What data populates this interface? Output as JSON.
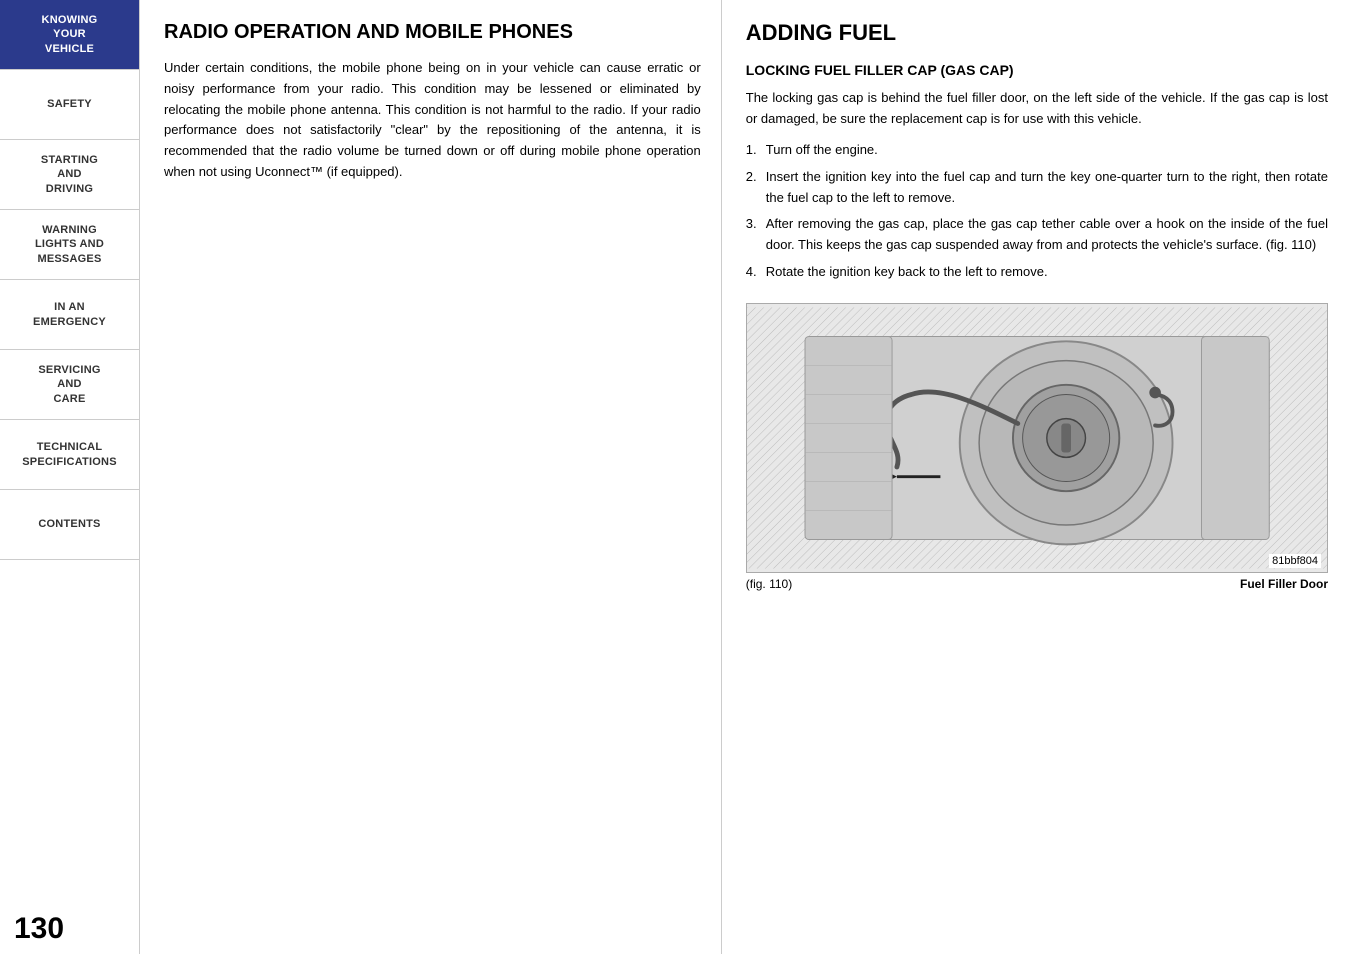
{
  "sidebar": {
    "items": [
      {
        "id": "knowing-your-vehicle",
        "label": "KNOWING\nYOUR\nVEHICLE",
        "active": true
      },
      {
        "id": "safety",
        "label": "SAFETY",
        "active": false
      },
      {
        "id": "starting-and-driving",
        "label": "STARTING\nAND\nDRIVING",
        "active": false
      },
      {
        "id": "warning-lights-and-messages",
        "label": "WARNING\nLIGHTS AND\nMESSAGES",
        "active": false
      },
      {
        "id": "in-an-emergency",
        "label": "IN AN\nEMERGENCY",
        "active": false
      },
      {
        "id": "servicing-and-care",
        "label": "SERVICING\nAND\nCARE",
        "active": false
      },
      {
        "id": "technical-specifications",
        "label": "TECHNICAL\nSPECIFICATIONS",
        "active": false
      },
      {
        "id": "contents",
        "label": "CONTENTS",
        "active": false
      }
    ],
    "page_number": "130"
  },
  "left_section": {
    "title": "RADIO OPERATION AND MOBILE PHONES",
    "body": "Under certain conditions, the mobile phone being on in your vehicle can cause erratic or noisy performance from your radio. This condition may be lessened or eliminated by relocating the mobile phone antenna. This condition is not harmful to the radio. If your radio performance does not satisfactorily \"clear\" by the repositioning of the antenna, it is recommended that the radio volume be turned down or off during mobile phone operation when not using Uconnect™ (if equipped)."
  },
  "right_section": {
    "title": "ADDING FUEL",
    "subsection_title": "LOCKING FUEL FILLER CAP (GAS CAP)",
    "intro": "The locking gas cap is behind the fuel filler door, on the left side of the vehicle. If the gas cap is lost or damaged, be sure the replacement cap is for use with this vehicle.",
    "steps": [
      {
        "num": "1.",
        "text": "Turn off the engine."
      },
      {
        "num": "2.",
        "text": "Insert the ignition key into the fuel cap and turn the key one-quarter turn to the right, then rotate the fuel cap to the left to remove."
      },
      {
        "num": "3.",
        "text": "After removing the gas cap, place the gas cap tether cable over a hook on the inside of the fuel door. This keeps the gas cap suspended away from and protects the vehicle's surface. (fig. 110)"
      },
      {
        "num": "4.",
        "text": "Rotate the ignition key back to the left to remove."
      }
    ],
    "figure": {
      "id": "81bbf804",
      "caption_left": "(fig. 110)",
      "caption_right": "Fuel Filler Door"
    }
  }
}
